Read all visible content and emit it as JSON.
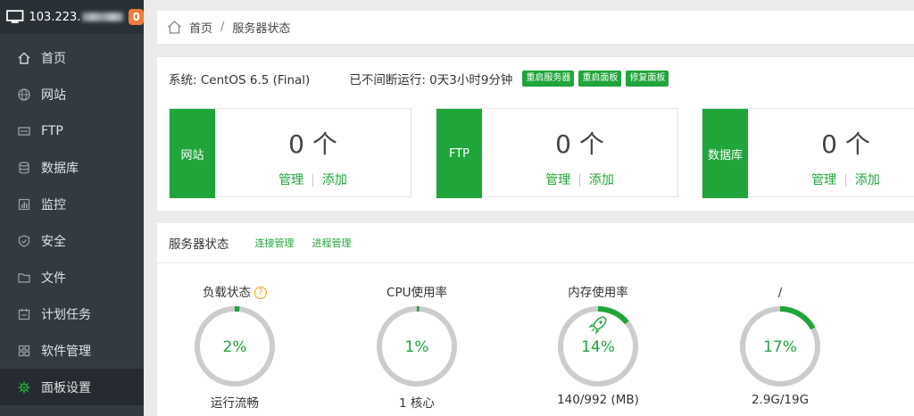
{
  "sidebar": {
    "server_ip": "103.223.",
    "notice_count": "0",
    "items": [
      {
        "label": "首页",
        "icon": "home-icon"
      },
      {
        "label": "网站",
        "icon": "globe-icon"
      },
      {
        "label": "FTP",
        "icon": "ftp-icon"
      },
      {
        "label": "数据库",
        "icon": "database-icon"
      },
      {
        "label": "监控",
        "icon": "monitor-icon"
      },
      {
        "label": "安全",
        "icon": "shield-icon"
      },
      {
        "label": "文件",
        "icon": "folder-icon"
      },
      {
        "label": "计划任务",
        "icon": "calendar-icon"
      },
      {
        "label": "软件管理",
        "icon": "apps-icon"
      },
      {
        "label": "面板设置",
        "icon": "gear-icon"
      }
    ],
    "active_index": 9,
    "accent": "#20a53a"
  },
  "breadcrumb": {
    "home": "首页",
    "separator": "/",
    "current": "服务器状态"
  },
  "system": {
    "os_text": "系统: CentOS 6.5 (Final)",
    "uptime_text": "已不间断运行: 0天3小时9分钟",
    "buttons": [
      "重启服务器",
      "重启面板",
      "修复面板"
    ]
  },
  "cards": [
    {
      "label": "网站",
      "count": "0 个",
      "manage": "管理",
      "add": "添加"
    },
    {
      "label": "FTP",
      "count": "0 个",
      "manage": "管理",
      "add": "添加"
    },
    {
      "label": "数据库",
      "count": "0 个",
      "manage": "管理",
      "add": "添加"
    }
  ],
  "status": {
    "title": "服务器状态",
    "links": [
      "连接管理",
      "进程管理"
    ],
    "gauges": [
      {
        "title": "负载状态",
        "percent_text": "2%",
        "percent": 2,
        "sub": "运行流畅",
        "help": "?"
      },
      {
        "title": "CPU使用率",
        "percent_text": "1%",
        "percent": 1,
        "sub": "1 核心"
      },
      {
        "title": "内存使用率",
        "percent_text": "14%",
        "percent": 14,
        "sub": "140/992 (MB)",
        "icon": "rocket-icon"
      },
      {
        "title": "/",
        "percent_text": "17%",
        "percent": 17,
        "sub": "2.9G/19G"
      }
    ]
  },
  "colors": {
    "green": "#20a53a",
    "sidebar": "#323b41",
    "ring_track": "#cccccc",
    "badge": "#f07c3a"
  }
}
